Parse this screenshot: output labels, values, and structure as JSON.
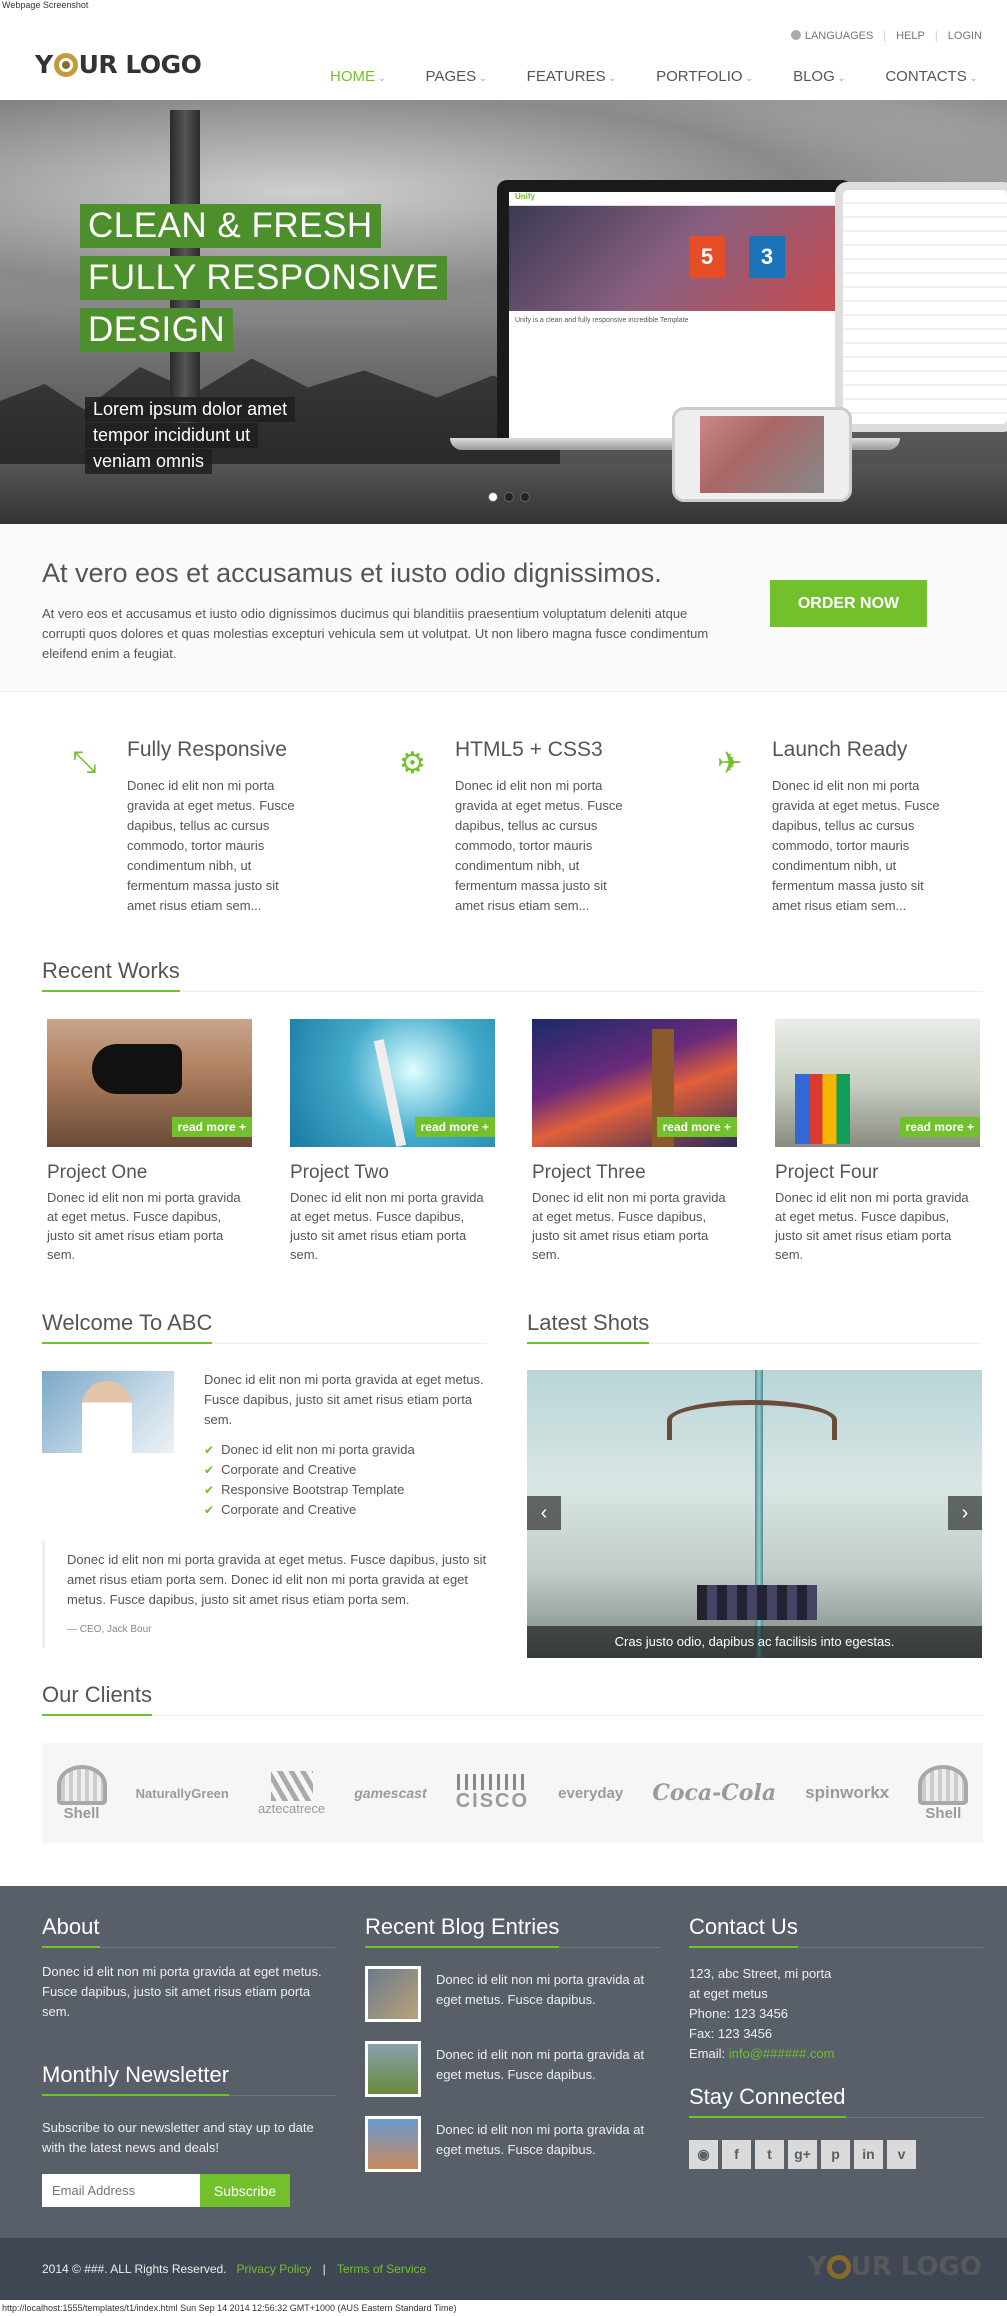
{
  "browser": {
    "caption": "Webpage Screenshot",
    "status_url": "http://localhost:1555/templates/t1/index.html Sun Sep 14 2014 12:56:32 GMT+1000 (AUS Eastern Standard Time)"
  },
  "topbar": {
    "languages": "LANGUAGES",
    "help": "HELP",
    "login": "LOGIN"
  },
  "logo": {
    "pre": "Y",
    "post": "UR LOGO"
  },
  "nav": [
    {
      "label": "HOME"
    },
    {
      "label": "PAGES"
    },
    {
      "label": "FEATURES"
    },
    {
      "label": "PORTFOLIO"
    },
    {
      "label": "BLOG"
    },
    {
      "label": "CONTACTS"
    }
  ],
  "hero": {
    "line1": "CLEAN & FRESH",
    "line2": "FULLY RESPONSIVE",
    "line3": "DESIGN",
    "sub1": "Lorem ipsum dolor amet",
    "sub2": "tempor incididunt ut",
    "sub3": "veniam omnis",
    "device_brand": "Unify",
    "device_tagline": "Unify is a clean and fully responsive incredible Template"
  },
  "purchase": {
    "title": "At vero eos et accusamus et iusto odio dignissimos.",
    "text": "At vero eos et accusamus et iusto odio dignissimos ducimus qui blanditiis praesentium voluptatum deleniti atque corrupti quos dolores et quas molestias excepturi vehicula sem ut volutpat. Ut non libero magna fusce condimentum eleifend enim a feugiat.",
    "button": "ORDER NOW"
  },
  "services": [
    {
      "icon": "compress-arrows-icon",
      "title": "Fully Responsive",
      "text": "Donec id elit non mi porta gravida at eget metus. Fusce dapibus, tellus ac cursus commodo, tortor mauris condimentum nibh, ut fermentum massa justo sit amet risus etiam sem..."
    },
    {
      "icon": "gears-icon",
      "title": "HTML5 + CSS3",
      "text": "Donec id elit non mi porta gravida at eget metus. Fusce dapibus, tellus ac cursus commodo, tortor mauris condimentum nibh, ut fermentum massa justo sit amet risus etiam sem..."
    },
    {
      "icon": "plane-icon",
      "title": "Launch Ready",
      "text": "Donec id elit non mi porta gravida at eget metus. Fusce dapibus, tellus ac cursus commodo, tortor mauris condimentum nibh, ut fermentum massa justo sit amet risus etiam sem..."
    }
  ],
  "recent_works": {
    "heading": "Recent Works",
    "read_more": "read more +",
    "items": [
      {
        "title": "Project One",
        "text": "Donec id elit non mi porta gravida at eget metus. Fusce dapibus, justo sit amet risus etiam porta sem."
      },
      {
        "title": "Project Two",
        "text": "Donec id elit non mi porta gravida at eget metus. Fusce dapibus, justo sit amet risus etiam porta sem."
      },
      {
        "title": "Project Three",
        "text": "Donec id elit non mi porta gravida at eget metus. Fusce dapibus, justo sit amet risus etiam porta sem."
      },
      {
        "title": "Project Four",
        "text": "Donec id elit non mi porta gravida at eget metus. Fusce dapibus, justo sit amet risus etiam porta sem."
      }
    ]
  },
  "welcome": {
    "heading": "Welcome To ABC",
    "text": "Donec id elit non mi porta gravida at eget metus. Fusce dapibus, justo sit amet risus etiam porta sem.",
    "checklist": [
      "Donec id elit non mi porta gravida",
      "Corporate and Creative",
      "Responsive Bootstrap Template",
      "Corporate and Creative"
    ],
    "quote": "Donec id elit non mi porta gravida at eget metus. Fusce dapibus, justo sit amet risus etiam porta sem. Donec id elit non mi porta gravida at eget metus. Fusce dapibus, justo sit amet risus etiam porta sem.",
    "quote_author": "— CEO, Jack Bour"
  },
  "latest_shots": {
    "heading": "Latest Shots",
    "caption": "Cras justo odio, dapibus ac facilisis into egestas.",
    "prev": "‹",
    "next": "›"
  },
  "clients": {
    "heading": "Our Clients",
    "logos": [
      "Shell",
      "NaturallyGreen",
      "aztecatrece",
      "gamescast",
      "CISCO",
      "everyday",
      "Coca-Cola",
      "spinworkx",
      "Shell"
    ]
  },
  "footer": {
    "about_heading": "About",
    "about_text": "Donec id elit non mi porta gravida at eget metus. Fusce dapibus, justo sit amet risus etiam porta sem.",
    "newsletter_heading": "Monthly Newsletter",
    "newsletter_text": "Subscribe to our newsletter and stay up to date with the latest news and deals!",
    "email_placeholder": "Email Address",
    "subscribe": "Subscribe",
    "blog_heading": "Recent Blog Entries",
    "blog_entries": [
      "Donec id elit non mi porta gravida at eget metus. Fusce dapibus.",
      "Donec id elit non mi porta gravida at eget metus. Fusce dapibus.",
      "Donec id elit non mi porta gravida at eget metus. Fusce dapibus."
    ],
    "contact_heading": "Contact Us",
    "address1": "123, abc Street, mi porta",
    "address2": "at eget metus",
    "phone": "Phone: 123 3456",
    "fax": "Fax: 123 3456",
    "email_label": "Email: ",
    "email": "info@######.com",
    "stay_heading": "Stay Connected",
    "social": [
      "rss-icon",
      "facebook-icon",
      "twitter-icon",
      "googleplus-icon",
      "pinterest-icon",
      "linkedin-icon",
      "vimeo-icon"
    ]
  },
  "copyright": {
    "text": "2014 © ###. ALL Rights Reserved.",
    "privacy": "Privacy Policy",
    "sep": "|",
    "terms": "Terms of Service"
  },
  "colors": {
    "accent": "#72c02c",
    "footer_bg": "#585f69",
    "copyright_bg": "#3e4753"
  }
}
